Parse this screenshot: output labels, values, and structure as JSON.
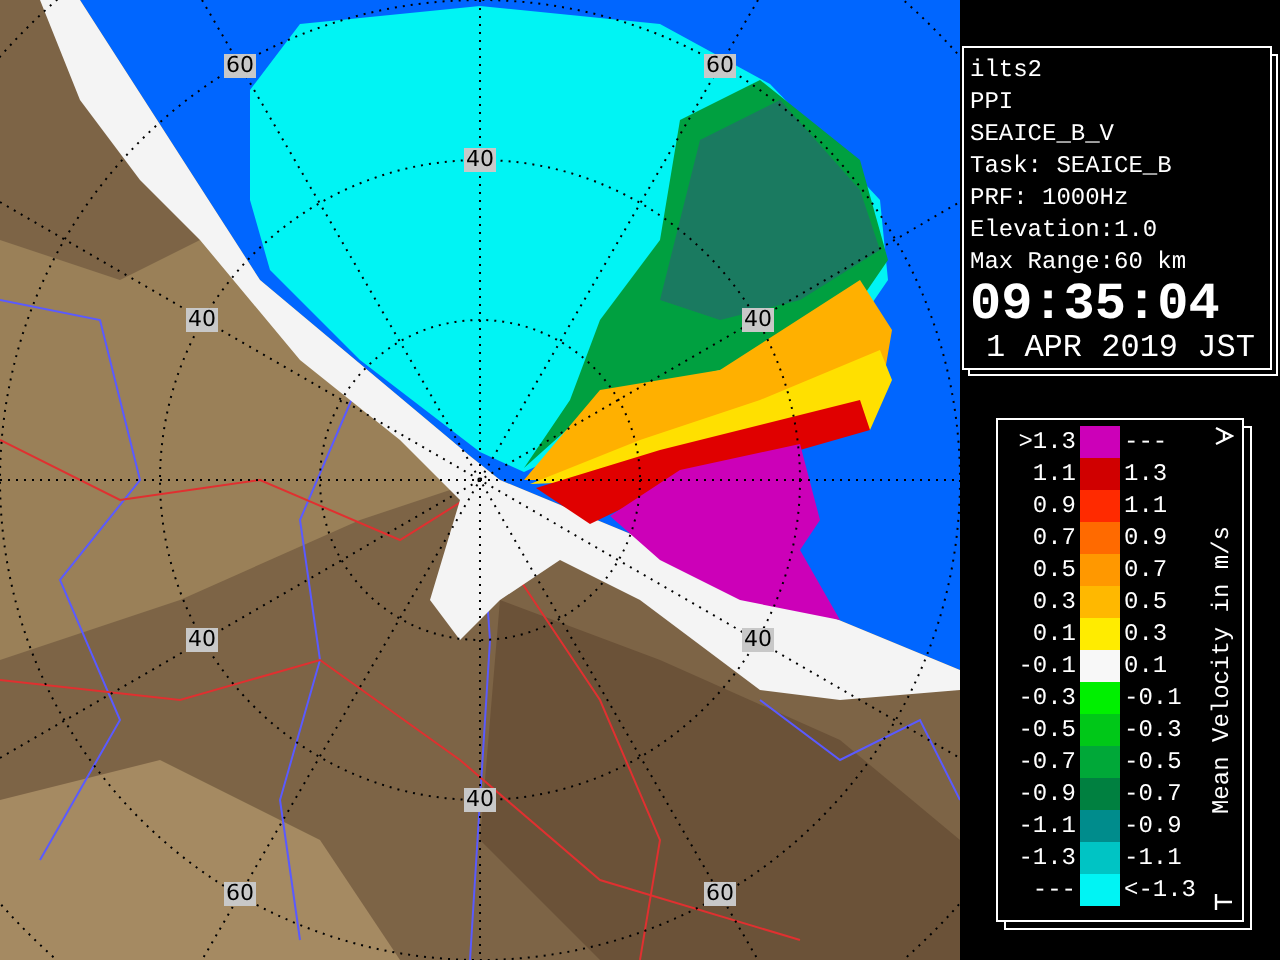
{
  "radar_map": {
    "range_labels": [
      "60",
      "60",
      "40",
      "40",
      "40",
      "40",
      "40",
      "40",
      "60",
      "60"
    ]
  },
  "info_panel": {
    "lines": [
      "ilts2",
      "PPI",
      "SEAICE_B_V",
      "Task: SEAICE_B",
      "PRF: 1000Hz",
      "Elevation:1.0",
      "Max Range:60 km"
    ],
    "time": "09:35:04",
    "date": "1 APR 2019 JST"
  },
  "legend": {
    "title": "Mean Velocity in m/s",
    "rows": [
      {
        "low": ">1.3",
        "high": "---",
        "color": "#cc00b8"
      },
      {
        "low": "1.1",
        "high": "1.3",
        "color": "#d00000"
      },
      {
        "low": "0.9",
        "high": "1.1",
        "color": "#ff2a00"
      },
      {
        "low": "0.7",
        "high": "0.9",
        "color": "#ff6a00"
      },
      {
        "low": "0.5",
        "high": "0.7",
        "color": "#ff9800"
      },
      {
        "low": "0.3",
        "high": "0.5",
        "color": "#ffb800"
      },
      {
        "low": "0.1",
        "high": "0.3",
        "color": "#ffec00"
      },
      {
        "low": "-0.1",
        "high": "0.1",
        "color": "#f8f8f8"
      },
      {
        "low": "-0.3",
        "high": "-0.1",
        "color": "#00f000"
      },
      {
        "low": "-0.5",
        "high": "-0.3",
        "color": "#00c818"
      },
      {
        "low": "-0.7",
        "high": "-0.5",
        "color": "#00a838"
      },
      {
        "low": "-0.9",
        "high": "-0.7",
        "color": "#008040"
      },
      {
        "low": "-1.1",
        "high": "-0.9",
        "color": "#008c8c"
      },
      {
        "low": "-1.3",
        "high": "-1.1",
        "color": "#00c4c4"
      },
      {
        "low": "---",
        "high": "<-1.3",
        "color": "#00f4f4"
      }
    ]
  }
}
